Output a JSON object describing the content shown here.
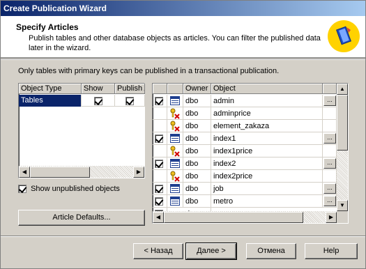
{
  "window": {
    "title": "Create Publication Wizard"
  },
  "header": {
    "title": "Specify Articles",
    "description": "Publish tables and other database objects as articles. You can filter the published data later in the wizard."
  },
  "note": "Only tables with primary keys can be published in a transactional publication.",
  "left_grid": {
    "columns": [
      "Object Type",
      "Show",
      "Publish All"
    ],
    "rows": [
      {
        "type": "Tables",
        "show": true,
        "publish_all": true
      }
    ]
  },
  "show_unpublished": {
    "label": "Show unpublished objects",
    "checked": true
  },
  "article_defaults_label": "Article Defaults...",
  "right_grid": {
    "columns": [
      "",
      "",
      "Owner",
      "Object",
      ""
    ],
    "rows": [
      {
        "checked": true,
        "icon": "table-icon",
        "owner": "dbo",
        "object": "admin",
        "button": "..."
      },
      {
        "checked": false,
        "icon": "no-key-icon",
        "owner": "dbo",
        "object": "adminprice",
        "button": ""
      },
      {
        "checked": false,
        "icon": "no-key-icon",
        "owner": "dbo",
        "object": "element_zakaza",
        "button": ""
      },
      {
        "checked": true,
        "icon": "table-icon",
        "owner": "dbo",
        "object": "index1",
        "button": "..."
      },
      {
        "checked": false,
        "icon": "no-key-icon",
        "owner": "dbo",
        "object": "index1price",
        "button": ""
      },
      {
        "checked": true,
        "icon": "table-icon",
        "owner": "dbo",
        "object": "index2",
        "button": "..."
      },
      {
        "checked": false,
        "icon": "no-key-icon",
        "owner": "dbo",
        "object": "index2price",
        "button": ""
      },
      {
        "checked": true,
        "icon": "table-icon",
        "owner": "dbo",
        "object": "job",
        "button": "..."
      },
      {
        "checked": true,
        "icon": "table-icon",
        "owner": "dbo",
        "object": "metro",
        "button": "..."
      }
    ],
    "partial_row_owner": "d"
  },
  "buttons": {
    "back": "< Назад",
    "next": "Далее >",
    "cancel": "Отмена",
    "help": "Help"
  },
  "colors": {
    "selection": "#0a246a",
    "title_gradient_start": "#0a246a",
    "icon_yellow": "#ffd200"
  }
}
